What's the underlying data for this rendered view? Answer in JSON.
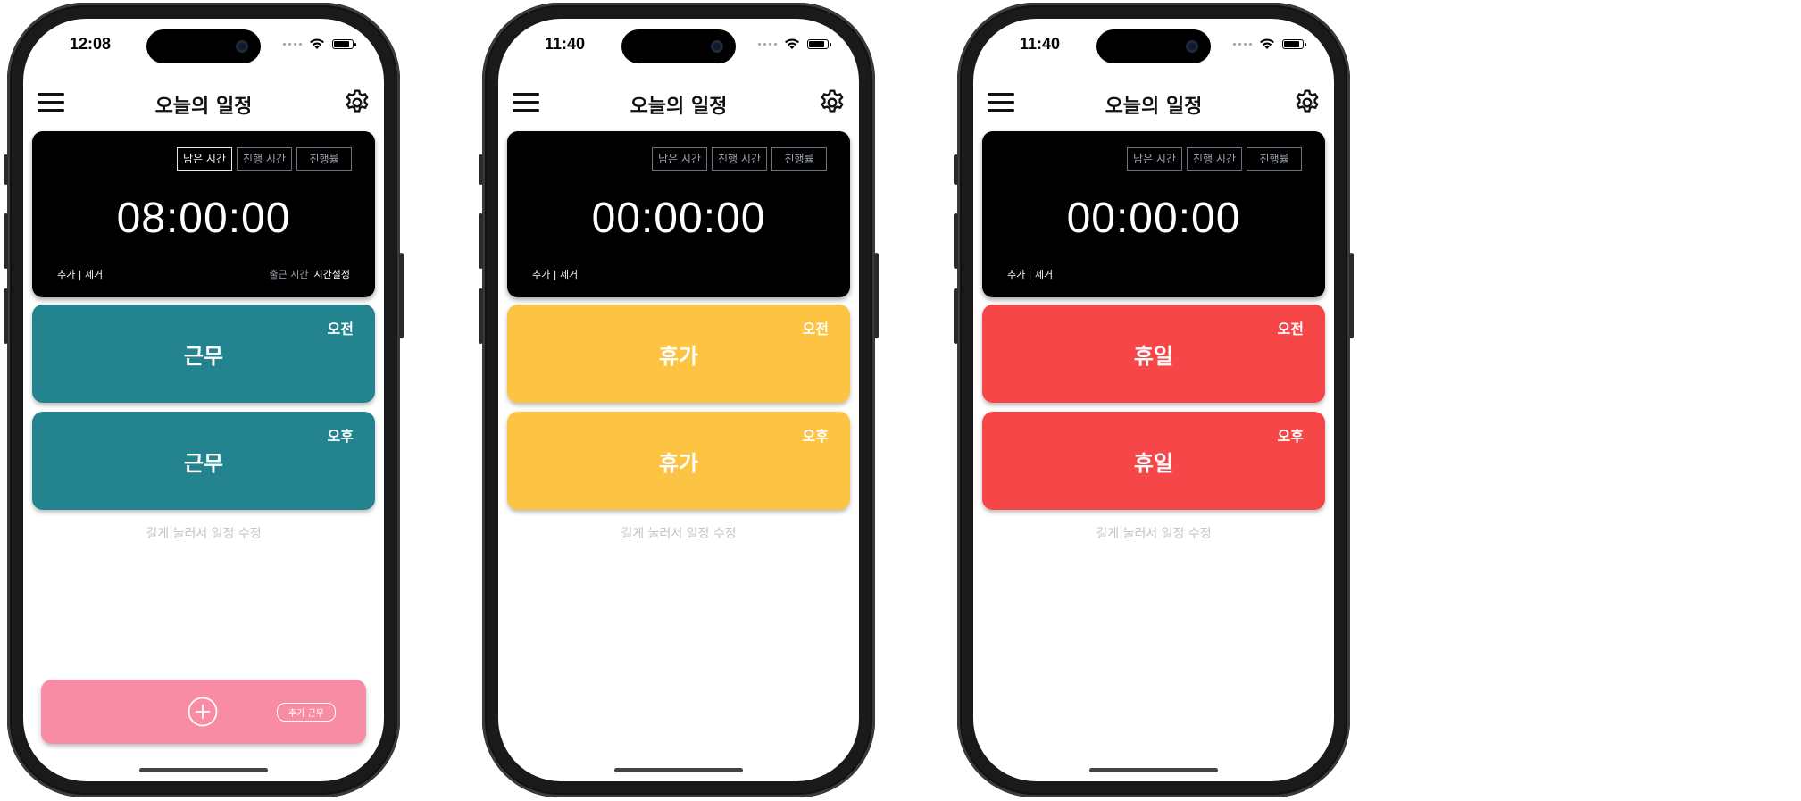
{
  "colors": {
    "work": "#23838f",
    "vacation": "#fdc443",
    "holiday": "#f74647",
    "add_card": "#f98ca5"
  },
  "screens": [
    {
      "status_time": "12:08",
      "title": "오늘의 일정",
      "timer": {
        "tabs": [
          "남은 시간",
          "진행 시간",
          "진행률"
        ],
        "active_tab": "남은 시간",
        "value": "08:00:00",
        "add_remove": "추가 | 제거",
        "clockin_label": "출근 시간",
        "time_setting": "시간설정"
      },
      "slots": [
        {
          "label": "근무",
          "period": "오전"
        },
        {
          "label": "근무",
          "period": "오후"
        }
      ],
      "hint": "길게 눌러서 일정 수정",
      "add_card": {
        "button": "add-icon",
        "extra_work": "추가 근무"
      }
    },
    {
      "status_time": "11:40",
      "title": "오늘의 일정",
      "timer": {
        "tabs": [
          "남은 시간",
          "진행 시간",
          "진행률"
        ],
        "value": "00:00:00",
        "add_remove": "추가 | 제거"
      },
      "slots": [
        {
          "label": "휴가",
          "period": "오전"
        },
        {
          "label": "휴가",
          "period": "오후"
        }
      ],
      "hint": "길게 눌러서 일정 수정"
    },
    {
      "status_time": "11:40",
      "title": "오늘의 일정",
      "timer": {
        "tabs": [
          "남은 시간",
          "진행 시간",
          "진행률"
        ],
        "value": "00:00:00",
        "add_remove": "추가 | 제거"
      },
      "slots": [
        {
          "label": "휴일",
          "period": "오전"
        },
        {
          "label": "휴일",
          "period": "오후"
        }
      ],
      "hint": "길게 눌러서 일정 수정"
    }
  ]
}
